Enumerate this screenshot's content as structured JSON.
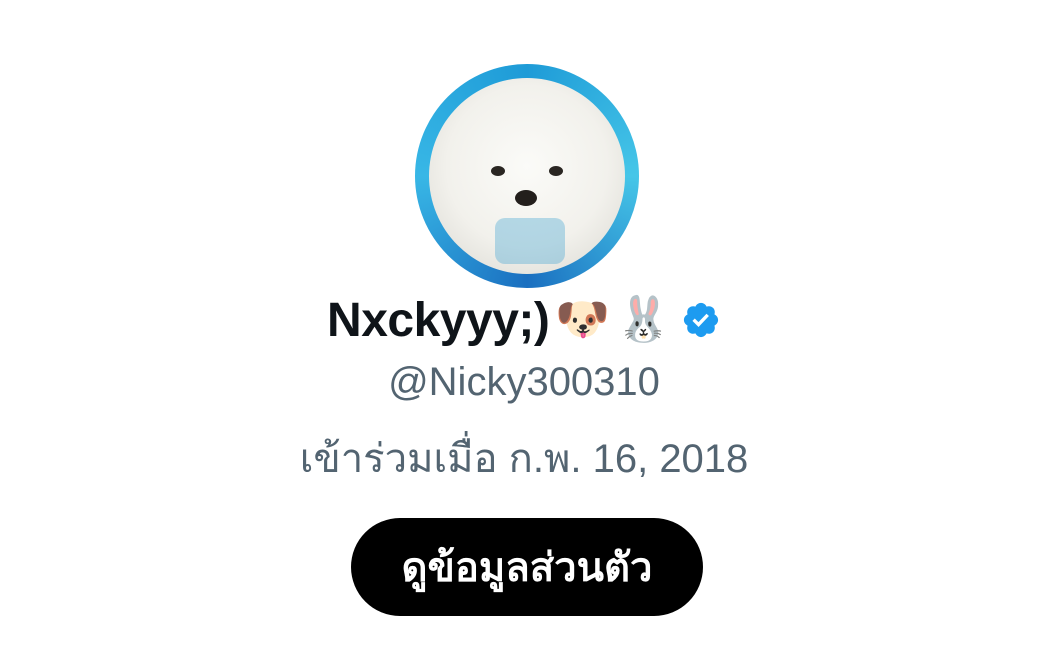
{
  "profile": {
    "display_name": "Nxckyyy;)",
    "emojis": [
      "🐶",
      "🐰"
    ],
    "verified_icon": "verified-badge-icon",
    "handle": "@Nicky300310",
    "joined": "เข้าร่วมเมื่อ ก.พ. 16, 2018",
    "view_profile_label": "ดูข้อมูลส่วนตัว"
  },
  "colors": {
    "name": "#0f1419",
    "secondary_text": "#536471",
    "button_bg": "#000000",
    "button_text": "#ffffff",
    "verified_blue": "#1d9bf0"
  }
}
